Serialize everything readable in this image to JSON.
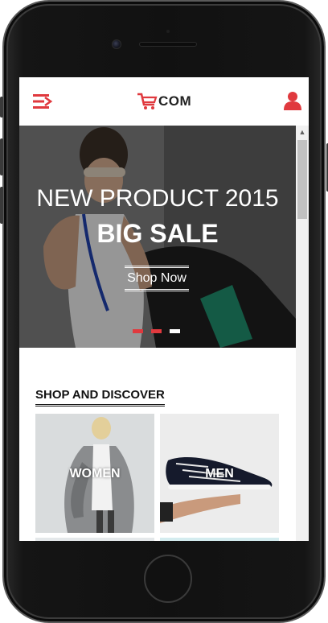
{
  "header": {
    "logo_text": "COM",
    "accent_color": "#e0393e"
  },
  "hero": {
    "title": "NEW PRODUCT 2015",
    "subtitle": "BIG SALE",
    "cta_label": "Shop Now",
    "slides_total": 3,
    "active_slide": 3
  },
  "section": {
    "title": "SHOP AND DISCOVER"
  },
  "categories": [
    {
      "label": "WOMEN"
    },
    {
      "label": "MEN"
    }
  ],
  "icons": {
    "menu": "menu-arrow-icon",
    "cart": "cart-icon",
    "user": "user-icon",
    "scroll_up": "scroll-up-arrow"
  }
}
